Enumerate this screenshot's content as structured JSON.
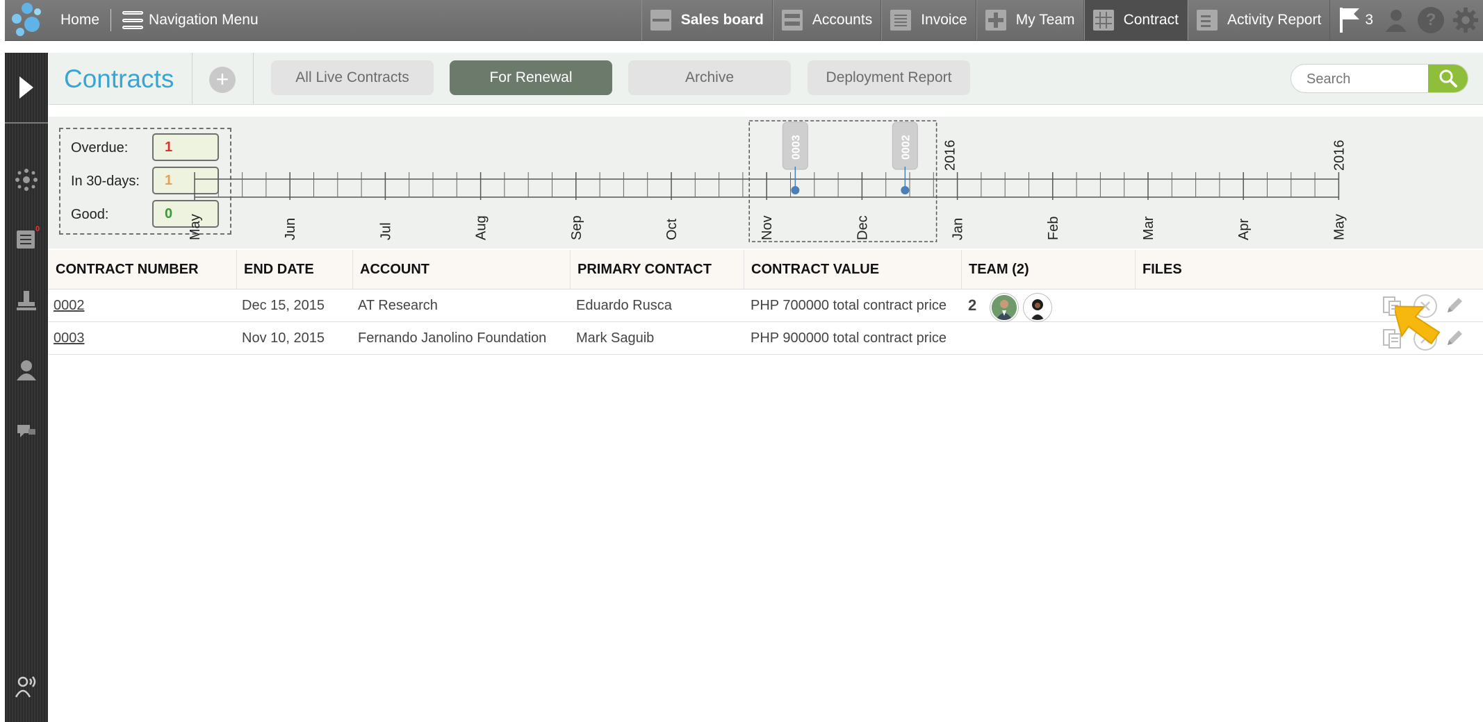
{
  "topbar": {
    "home": "Home",
    "navigation_menu": "Navigation Menu",
    "items": [
      {
        "label": "Sales board",
        "icon": "sales-board-icon"
      },
      {
        "label": "Accounts",
        "icon": "accounts-icon"
      },
      {
        "label": "Invoice",
        "icon": "invoice-icon"
      },
      {
        "label": "My Team",
        "icon": "my-team-icon"
      },
      {
        "label": "Contract",
        "icon": "contract-icon",
        "active": true
      },
      {
        "label": "Activity Report",
        "icon": "activity-report-icon"
      }
    ],
    "flag_count": "3",
    "icons": [
      "user-icon",
      "help-icon",
      "settings-icon"
    ]
  },
  "sidebar": {
    "badge": "0",
    "icons": [
      "expand-icon",
      "network-icon",
      "list-icon",
      "stamp-icon",
      "user-icon",
      "chat-icon",
      "contact-broadcast-icon"
    ]
  },
  "header": {
    "title": "Contracts",
    "add": "+",
    "tabs": [
      "All Live Contracts",
      "For Renewal",
      "Archive",
      "Deployment Report"
    ],
    "active_tab": "For Renewal",
    "search_placeholder": "Search"
  },
  "status": {
    "overdue_label": "Overdue:",
    "overdue_value": "1",
    "in30_label": "In 30-days:",
    "in30_value": "1",
    "good_label": "Good:",
    "good_value": "0",
    "colors": {
      "overdue": "#d9342b",
      "in30": "#e0a25a",
      "good": "#3a9a3a"
    }
  },
  "timeline": {
    "months": [
      "May",
      "Jun",
      "Jul",
      "Aug",
      "Sep",
      "Oct",
      "Nov",
      "Dec",
      "Jan",
      "Feb",
      "Mar",
      "Apr",
      "May"
    ],
    "year_labels": [
      {
        "after_month": "Dec",
        "label": "2016"
      },
      {
        "after_month": "Apr",
        "label": "2016"
      }
    ],
    "markers": [
      {
        "label": "0003",
        "date": "2015-11-10"
      },
      {
        "label": "0002",
        "date": "2015-12-15"
      }
    ]
  },
  "table": {
    "columns": [
      "CONTRACT NUMBER",
      "END DATE",
      "ACCOUNT",
      "PRIMARY CONTACT",
      "CONTRACT VALUE",
      "TEAM (2)",
      "FILES"
    ],
    "rows": [
      {
        "number": "0002",
        "end_date": "Dec 15, 2015",
        "account": "AT Research",
        "contact": "Eduardo Rusca",
        "value": "PHP 700000 total contract price",
        "team_count": "2"
      },
      {
        "number": "0003",
        "end_date": "Nov 10, 2015",
        "account": "Fernando Janolino Foundation",
        "contact": "Mark Saguib",
        "value": "PHP 900000 total contract price",
        "team_count": ""
      }
    ]
  }
}
